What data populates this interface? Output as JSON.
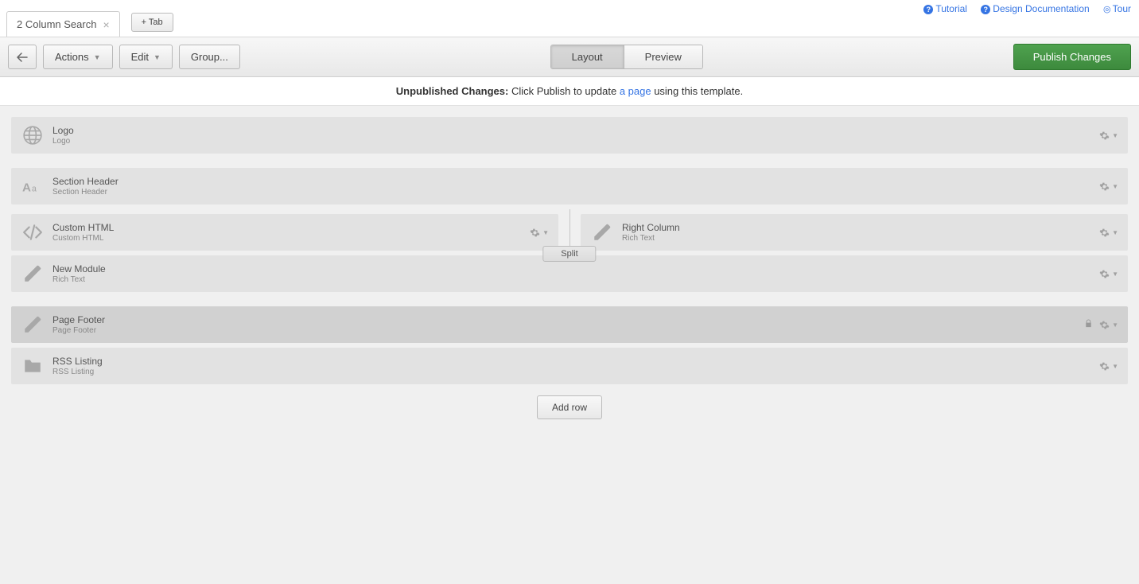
{
  "helpLinks": {
    "tutorial": "Tutorial",
    "designDoc": "Design Documentation",
    "tour": "Tour"
  },
  "tab": {
    "title": "2 Column Search",
    "addTab": "+ Tab"
  },
  "toolbar": {
    "actions": "Actions",
    "edit": "Edit",
    "group": "Group...",
    "layout": "Layout",
    "preview": "Preview",
    "publish": "Publish Changes"
  },
  "notice": {
    "prefix": "Unpublished Changes:",
    "text1": " Click Publish to update ",
    "link": "a page",
    "text2": " using this template."
  },
  "modules": {
    "logo": {
      "title": "Logo",
      "sub": "Logo"
    },
    "sectionHeader": {
      "title": "Section Header",
      "sub": "Section Header"
    },
    "customHtml": {
      "title": "Custom HTML",
      "sub": "Custom HTML"
    },
    "rightColumn": {
      "title": "Right Column",
      "sub": "Rich Text"
    },
    "newModule": {
      "title": "New Module",
      "sub": "Rich Text"
    },
    "pageFooter": {
      "title": "Page Footer",
      "sub": "Page Footer"
    },
    "rssListing": {
      "title": "RSS Listing",
      "sub": "RSS Listing"
    }
  },
  "split": "Split",
  "addRow": "Add row"
}
